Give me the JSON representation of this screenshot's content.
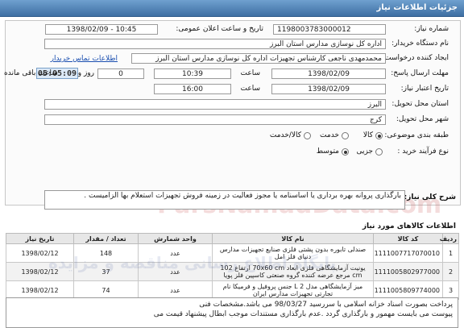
{
  "header": {
    "title": "جزئیات اطلاعات نیاز"
  },
  "form": {
    "need_number_label": "شماره نیاز:",
    "need_number": "1198003783000012",
    "announce_label": "تاریخ و ساعت اعلان عمومی:",
    "announce_value": "1398/02/09 - 10:45",
    "buyer_label": "نام دستگاه خریدار:",
    "buyer_value": "اداره کل نوسازی مدارس استان البرز",
    "creator_label": "ایجاد کننده درخواست:",
    "creator_value": "محمدمهدی ناجعی کارشناس تجهیزات اداره کل نوسازی مدارس استان البرز",
    "contact_link": "اطلاعات تماس خریدار",
    "response_label": "مهلت ارسال پاسخ:",
    "response_date": "1398/02/09",
    "response_time_label": "ساعت",
    "response_time": "10:39",
    "validity_label": "تاریخ اعتبار نیاز:",
    "validity_date": "1398/02/09",
    "validity_time_label": "ساعت",
    "validity_time": "16:00",
    "days_value": "0",
    "days_label": "روز و",
    "countdown": "05:05:09",
    "remaining_label": "ساعت باقی مانده",
    "province_label": "استان محل تحویل:",
    "province_value": "البرز",
    "city_label": "شهر محل تحویل:",
    "city_value": "کرج",
    "class_label": "طبقه بندی موضوعی:",
    "class_options": [
      "کالا",
      "خدمت",
      "کالا/خدمت"
    ],
    "class_selected": "کالا",
    "process_label": "نوع فرآیند خرید :",
    "process_options": [
      "جزیی",
      "متوسط"
    ],
    "process_selected": "متوسط"
  },
  "description": {
    "label": "شرح کلی نیاز:",
    "text": "بارگذاری پروانه بهره برداری یا اساسنامه یا مجوز فعالیت در زمینه فروش تجهیزات استعلام بها الزامیست ."
  },
  "items_section": {
    "title": "اطلاعات کالاهای مورد نیاز"
  },
  "table": {
    "headers": [
      "ردیف",
      "کد کالا",
      "نام کالا",
      "واحد شمارش",
      "تعداد / مقدار",
      "تاریخ نیاز"
    ],
    "rows": [
      [
        "1",
        "1111007717070010",
        "صندلی تابوره بدون پشتی فلزی صنایع تجهیزات مدارس دنیای فلز امل",
        "عدد",
        "148",
        "1398/02/12"
      ],
      [
        "2",
        "1111005802977000",
        "یونیت آزمایشگاهی فلزی ابعاد 70x60 cm ارتفاع 102 cm مرجع عرضه کننده گروه صنعتی کاسپین فلز پویا",
        "عدد",
        "37",
        "1398/02/12"
      ],
      [
        "3",
        "1111005809774000",
        "میز آزمایشگاهی مدل 2 L جنس پروفیل و فرمیکا نام تجارتی تجهیزات مدارس ایران",
        "عدد",
        "74",
        "1398/02/12"
      ]
    ]
  },
  "notes": {
    "line1": "پرداخت بصورت اسناد خزانه اسلامی با سررسید 98/03/27 می باشد.مشخصات فنی",
    "line2": "پیوست می بایست مهمور و بارگذاری گردد .عدم بارگذاری مستندات موجب ابطال پیشنهاد قیمت می"
  },
  "watermark": {
    "en": "ParsNamadData.com",
    "fa": "پایگاه اطلاع رسانی مناقصه و مزایده"
  },
  "colors": {
    "header": "#4a7bb0",
    "link": "#1b4fb0",
    "timer_bg": "#dce9f7"
  }
}
